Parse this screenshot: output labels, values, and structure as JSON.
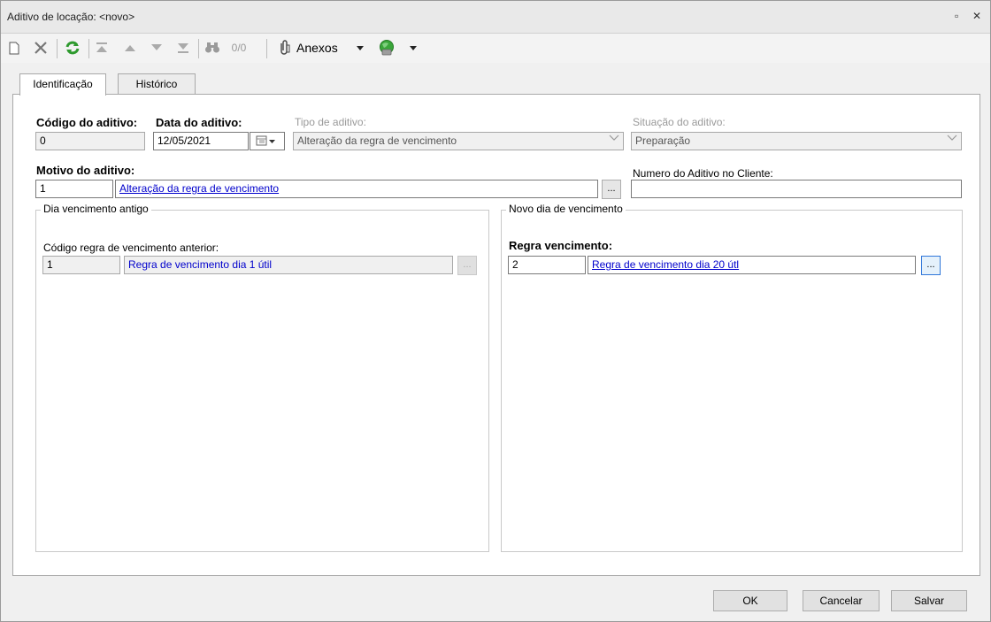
{
  "window": {
    "title": "Aditivo de locação: <novo>",
    "restore_glyph": "▫",
    "close_glyph": "✕"
  },
  "toolbar": {
    "counter": "0/0",
    "attachments_label": "Anexos"
  },
  "tabs": [
    {
      "label": "Identificação",
      "active": true
    },
    {
      "label": "Histórico",
      "active": false
    }
  ],
  "form": {
    "codigo_label": "Código do aditivo:",
    "codigo_value": "0",
    "data_label": "Data do aditivo:",
    "data_value": "12/05/2021",
    "tipo_label": "Tipo de aditivo:",
    "tipo_value": "Alteração da regra de vencimento",
    "situacao_label": "Situação do aditivo:",
    "situacao_value": "Preparação",
    "motivo_label": "Motivo do aditivo:",
    "motivo_code": "1",
    "motivo_desc": "Alteração da regra de vencimento",
    "numero_cliente_label": "Numero do Aditivo no Cliente:",
    "numero_cliente_value": "",
    "ellipsis": "..."
  },
  "old_group": {
    "title": "Dia vencimento antigo",
    "label": "Código regra de vencimento anterior:",
    "code": "1",
    "desc": "Regra de vencimento dia 1 útil"
  },
  "new_group": {
    "title": "Novo dia de vencimento",
    "label": "Regra vencimento:",
    "code": "2",
    "desc": "Regra de vencimento dia 20 útl"
  },
  "buttons": {
    "ok": "OK",
    "cancel": "Cancelar",
    "save": "Salvar"
  },
  "colors": {
    "refresh_green": "#2e9a2e",
    "link_blue": "#0000cc",
    "focus_blue": "#3077d9"
  }
}
